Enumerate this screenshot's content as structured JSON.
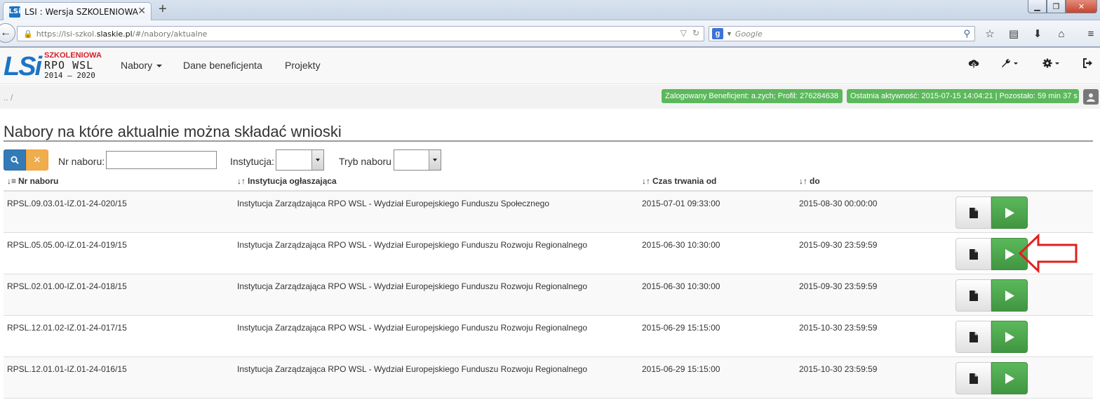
{
  "browser": {
    "tab_title": "LSI : Wersja SZKOLENIOWA",
    "favicon_text": "LSi",
    "url_prefix": "https://lsi-szkol.",
    "url_domain": "slaskie.pl",
    "url_path": "/#/nabory/aktualne",
    "search_engine_icon": "g",
    "search_placeholder": "Google"
  },
  "app": {
    "logo": {
      "lsi": "LSi",
      "szkoleniowa": "SZKOLENIOWA",
      "rpo": "RPO WSL",
      "years": "2014 – 2020"
    },
    "menu": {
      "nabory": "Nabory",
      "dane": "Dane beneficjenta",
      "projekty": "Projekty"
    },
    "status": {
      "crumb": ".. /",
      "user_badge": "Zalogowany Beneficjent: a.zych; Profil: 276284638",
      "activity_badge": "Ostatnia aktywność: 2015-07-15 14:04:21 | Pozostało: 59 min 37 s"
    }
  },
  "page": {
    "title": "Nabory na które aktualnie można składać wnioski",
    "filters": {
      "nr_label": "Nr naboru:",
      "inst_label": "Instytucja:",
      "tryb_label": "Tryb naboru",
      "nr_value": ""
    },
    "table": {
      "headers": {
        "nr": "Nr naboru",
        "inst": "Instytucja ogłaszająca",
        "od": "Czas trwania od",
        "do": "do"
      },
      "rows": [
        {
          "nr": "RPSL.09.03.01-IZ.01-24-020/15",
          "inst": "Instytucja Zarządzająca RPO WSL - Wydział Europejskiego Funduszu Społecznego",
          "od": "2015-07-01 09:33:00",
          "do": "2015-08-30 00:00:00"
        },
        {
          "nr": "RPSL.05.05.00-IZ.01-24-019/15",
          "inst": "Instytucja Zarządzająca RPO WSL - Wydział Europejskiego Funduszu Rozwoju Regionalnego",
          "od": "2015-06-30 10:30:00",
          "do": "2015-09-30 23:59:59"
        },
        {
          "nr": "RPSL.02.01.00-IZ.01-24-018/15",
          "inst": "Instytucja Zarządzająca RPO WSL - Wydział Europejskiego Funduszu Rozwoju Regionalnego",
          "od": "2015-06-30 10:30:00",
          "do": "2015-09-30 23:59:59"
        },
        {
          "nr": "RPSL.12.01.02-IZ.01-24-017/15",
          "inst": "Instytucja Zarządzająca RPO WSL - Wydział Europejskiego Funduszu Rozwoju Regionalnego",
          "od": "2015-06-29 15:15:00",
          "do": "2015-10-30 23:59:59"
        },
        {
          "nr": "RPSL.12.01.01-IZ.01-24-016/15",
          "inst": "Instytucja Zarządzająca RPO WSL - Wydział Europejskiego Funduszu Rozwoju Regionalnego",
          "od": "2015-06-29 15:15:00",
          "do": "2015-10-30 23:59:59"
        }
      ]
    }
  },
  "colors": {
    "primary": "#337ab7",
    "warning": "#f0ad4e",
    "success": "#5cb85c",
    "annotation": "#e02020",
    "logo_blue": "#1b74c4"
  }
}
